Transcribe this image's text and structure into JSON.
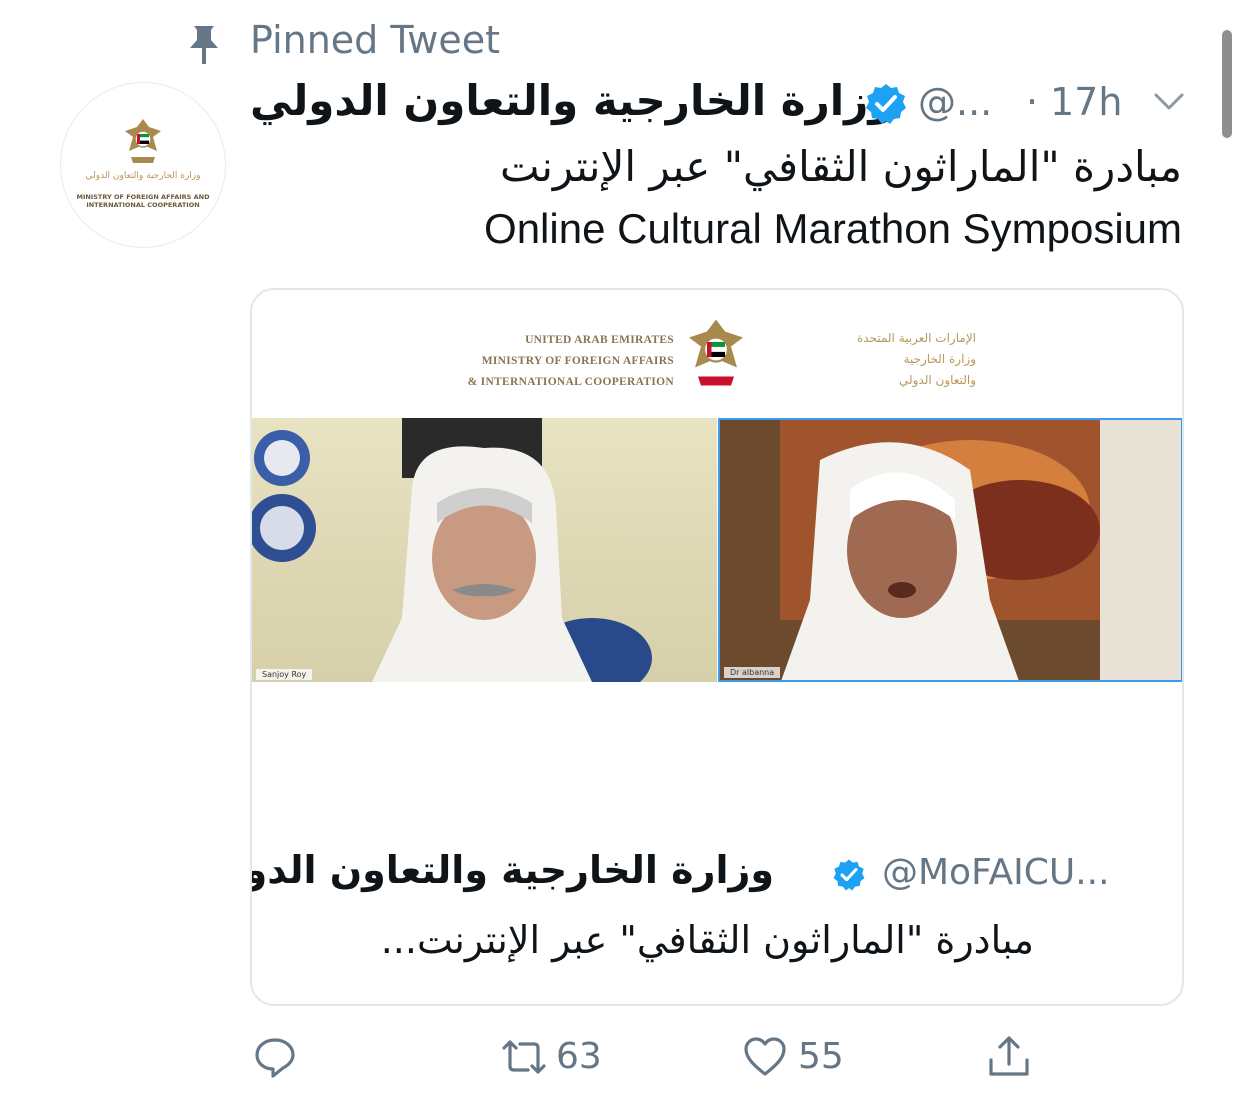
{
  "pinned": {
    "label": "Pinned Tweet",
    "icon": "pin-icon"
  },
  "author": {
    "name": "وزارة الخارجية والتعاون الدولي",
    "handle": "@...",
    "separator": "·",
    "time": "17h",
    "verified": true
  },
  "avatar": {
    "ar_text": "وزارة الخارجية والتعاون الدولي",
    "en_text": "MINISTRY OF FOREIGN AFFAIRS AND INTERNATIONAL COOPERATION"
  },
  "tweet": {
    "line_ar": "مبادرة \"الماراثون الثقافي\" عبر الإنترنت",
    "line_en": "Online Cultural Marathon Symposium"
  },
  "card": {
    "banner_en": [
      "UNITED ARAB EMIRATES",
      "MINISTRY OF FOREIGN AFFAIRS",
      "& INTERNATIONAL COOPERATION"
    ],
    "banner_ar": [
      "الإمارات العربية المتحدة",
      "وزارة الخارجية",
      "والتعاون الدولي"
    ],
    "video_left_label": "Sanjoy Roy",
    "video_right_label": "Dr albanna",
    "quote": {
      "name": "وزارة الخارجية والتعاون الدولي",
      "handle": "@MoFAICU...",
      "text": "مبادرة \"الماراثون الثقافي\" عبر الإنترنت..."
    }
  },
  "actions": {
    "reply_icon": "reply-icon",
    "retweet_count": "63",
    "like_count": "55",
    "share_icon": "share-icon"
  },
  "colors": {
    "accent": "#1da1f2",
    "muted": "#657786",
    "gold": "#b8975a"
  }
}
